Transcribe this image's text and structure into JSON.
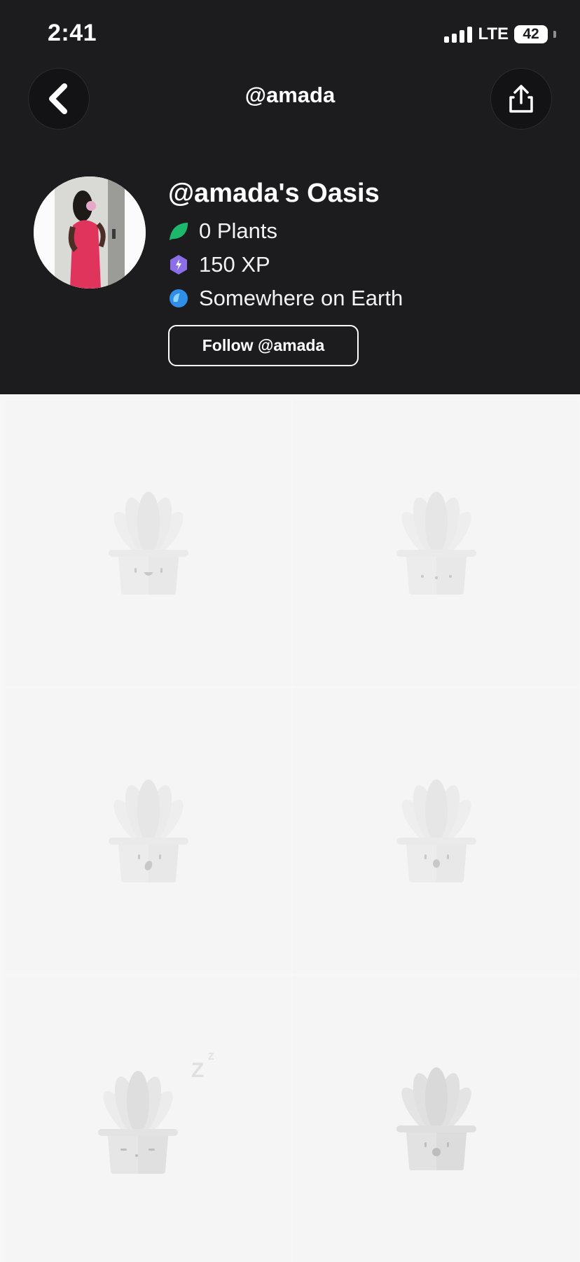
{
  "status_bar": {
    "time": "2:41",
    "network": "LTE",
    "battery": "42",
    "battery_level": 0.42
  },
  "nav": {
    "title": "@amada",
    "back_icon": "chevron-left-icon",
    "share_icon": "share-icon"
  },
  "profile": {
    "title": "@amada's Oasis",
    "plants": "0 Plants",
    "xp": "150 XP",
    "location": "Somewhere on Earth",
    "follow_label": "Follow @amada",
    "colors": {
      "leaf": "#1db86b",
      "xp": "#8b6ee8",
      "globe": "#2f8fe8"
    }
  },
  "placeholder_plants": [
    {
      "face": "smile"
    },
    {
      "face": "dots"
    },
    {
      "face": "surprised"
    },
    {
      "face": "open"
    },
    {
      "face": "sleep",
      "sleep_text": "Z"
    },
    {
      "face": "open"
    }
  ]
}
